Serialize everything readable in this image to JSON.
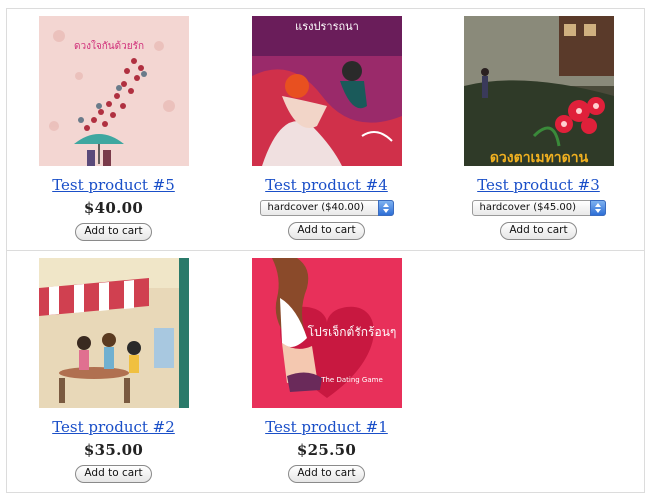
{
  "products": [
    {
      "title": "Test product #5",
      "price": "$40.00",
      "button_label": "Add to cart",
      "cover_icon": "book-cover-umbrella-roses",
      "cover_text": "ดวงใจกันด้วยรัก"
    },
    {
      "title": "Test product #4",
      "price": null,
      "format_select": "hardcover ($40.00)",
      "button_label": "Add to cart",
      "cover_icon": "book-cover-couple-motorbike",
      "cover_text": "แรงปรารถนา"
    },
    {
      "title": "Test product #3",
      "price": null,
      "format_select": "hardcover ($45.00)",
      "button_label": "Add to cart",
      "cover_icon": "book-cover-red-flowers-house",
      "cover_text": "ดวงตาเมทาดาน"
    },
    {
      "title": "Test product #2",
      "price": "$35.00",
      "button_label": "Add to cart",
      "cover_icon": "book-cover-cafe-scene"
    },
    {
      "title": "Test product #1",
      "price": "$25.50",
      "button_label": "Add to cart",
      "cover_icon": "book-cover-heart-girl",
      "cover_text": "โปรเจ็กต์รักร้อนๆ",
      "cover_subtitle": "The Dating Game"
    }
  ],
  "colors": {
    "link": "#1a4fc8",
    "border": "#dcdcdc",
    "select_arrow": "#2e6fd6"
  }
}
